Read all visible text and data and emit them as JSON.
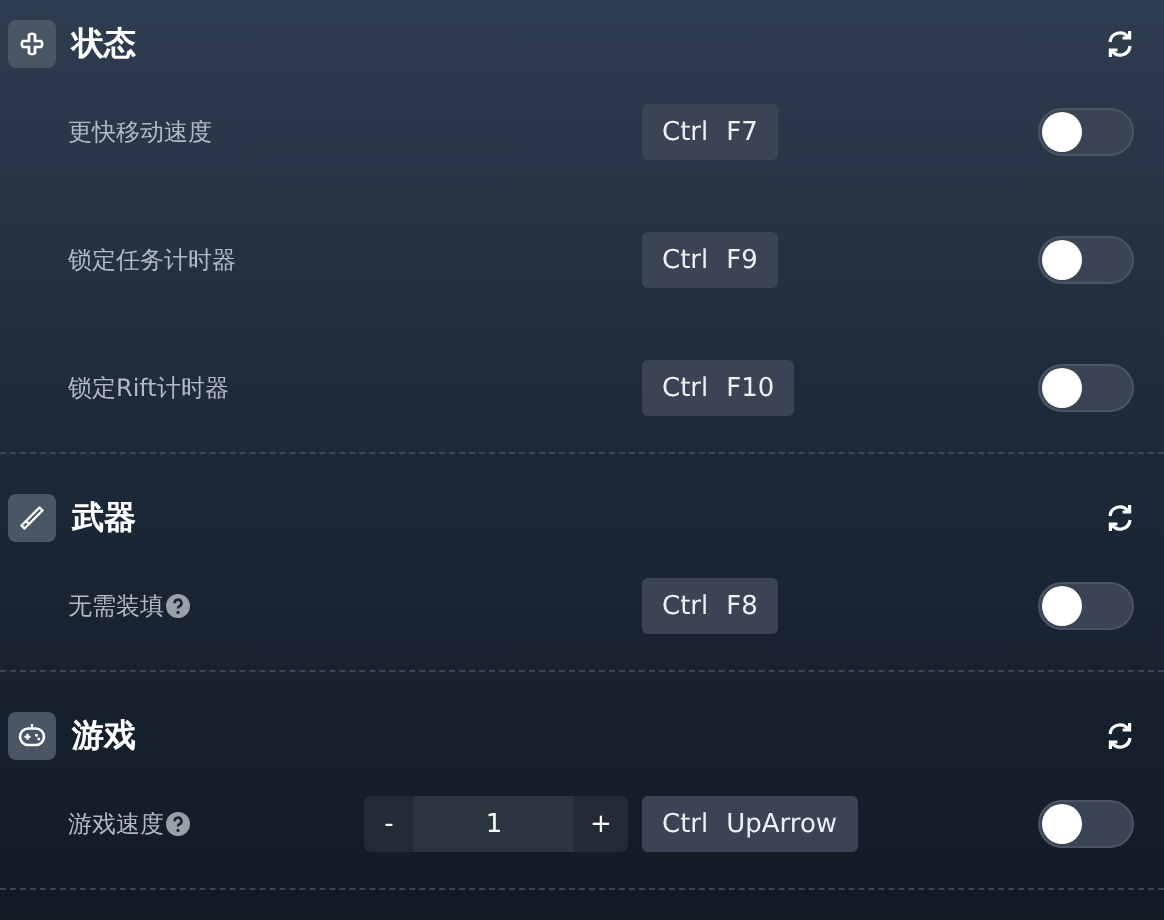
{
  "sections": [
    {
      "title": "状态",
      "rows": [
        {
          "label": "更快移动速度",
          "keys": [
            "Ctrl",
            "F7"
          ],
          "on": false
        },
        {
          "label": "锁定任务计时器",
          "keys": [
            "Ctrl",
            "F9"
          ],
          "on": false
        },
        {
          "label": "锁定Rift计时器",
          "keys": [
            "Ctrl",
            "F10"
          ],
          "on": false
        }
      ]
    },
    {
      "title": "武器",
      "rows": [
        {
          "label": "无需装填",
          "help": true,
          "keys": [
            "Ctrl",
            "F8"
          ],
          "on": false
        }
      ]
    },
    {
      "title": "游戏",
      "rows": [
        {
          "label": "游戏速度",
          "help": true,
          "stepper": {
            "minus": "-",
            "value": "1",
            "plus": "+"
          },
          "keys": [
            "Ctrl",
            "UpArrow"
          ],
          "on": false
        }
      ]
    }
  ]
}
